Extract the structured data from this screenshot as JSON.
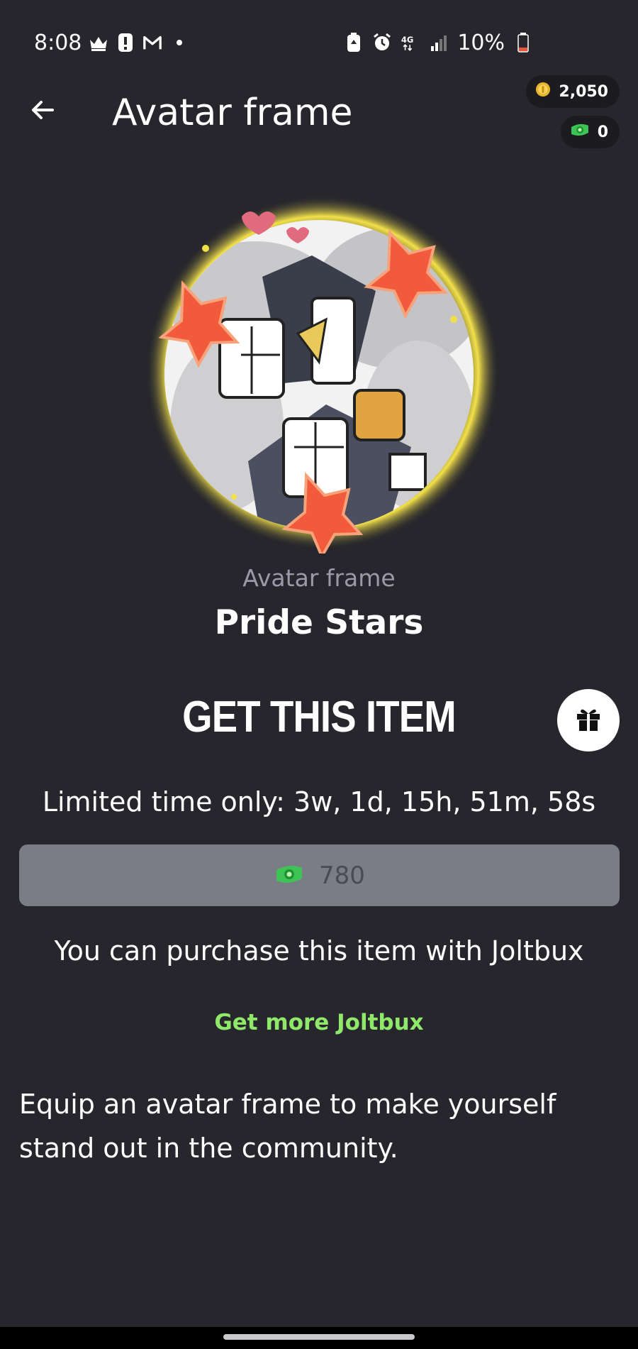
{
  "status_bar": {
    "time": "8:08",
    "battery": "10%",
    "network": "4G"
  },
  "header": {
    "title": "Avatar frame"
  },
  "wallet": {
    "coins": "2,050",
    "joltbux": "0"
  },
  "item": {
    "type_label": "Avatar frame",
    "name": "Pride Stars"
  },
  "purchase": {
    "heading": "GET THIS ITEM",
    "limited_time": "Limited time only: 3w, 1d, 15h, 51m, 58s",
    "price": "780",
    "note": "You can purchase this item with Joltbux",
    "get_more_link": "Get more Joltbux"
  },
  "description": "Equip an avatar frame to make yourself stand out in the community.",
  "colors": {
    "background": "#26262c",
    "price_button": "#7b7d86",
    "link_green": "#8fe86a",
    "star": "#f25a3c",
    "frame_glow": "#f2e04a"
  },
  "icons": {
    "back": "arrow-left-icon",
    "gift": "gift-icon",
    "coin": "coin-icon",
    "joltbux": "joltbux-icon"
  }
}
